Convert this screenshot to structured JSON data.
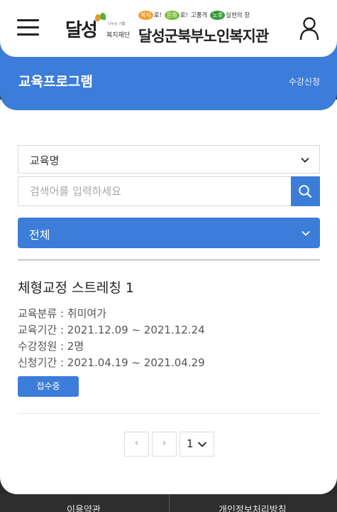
{
  "header": {
    "logo_left_text": "달성",
    "logo_left_sub": "복지재단",
    "logo_left_tiny": "나누는 기쁨",
    "slogan": [
      {
        "blob": "복지",
        "rest": "로!"
      },
      {
        "blob": "문화",
        "rest": "로!"
      },
      {
        "plain": "고품격"
      },
      {
        "blob": "노후",
        "rest": "실현의 장"
      }
    ],
    "org_name": "달성군북부노인복지관",
    "menu_icon": "hamburger-icon",
    "user_icon": "user-icon"
  },
  "banner": {
    "title": "교육프로그램",
    "link": "수강신청"
  },
  "search": {
    "category_selected": "교육명",
    "placeholder": "검색어를 입력하세요",
    "search_icon": "search-icon",
    "filter_selected": "전체"
  },
  "programs": [
    {
      "title": "체형교정 스트레칭 1",
      "rows": [
        "교육분류 : 취미여가",
        "교육기간 : 2021.12.09 ~ 2021.12.24",
        "수강정원 : 2명",
        "신청기간 : 2021.04.19 ~ 2021.04.29"
      ],
      "status": "접수중"
    }
  ],
  "pagination": {
    "prev": "‹",
    "next": "›",
    "current_page": "1"
  },
  "footer": {
    "terms": "이용약관",
    "privacy": "개인정보처리방침"
  },
  "colors": {
    "accent": "#3b7dd8",
    "footer_bg": "#2e2e2e"
  }
}
